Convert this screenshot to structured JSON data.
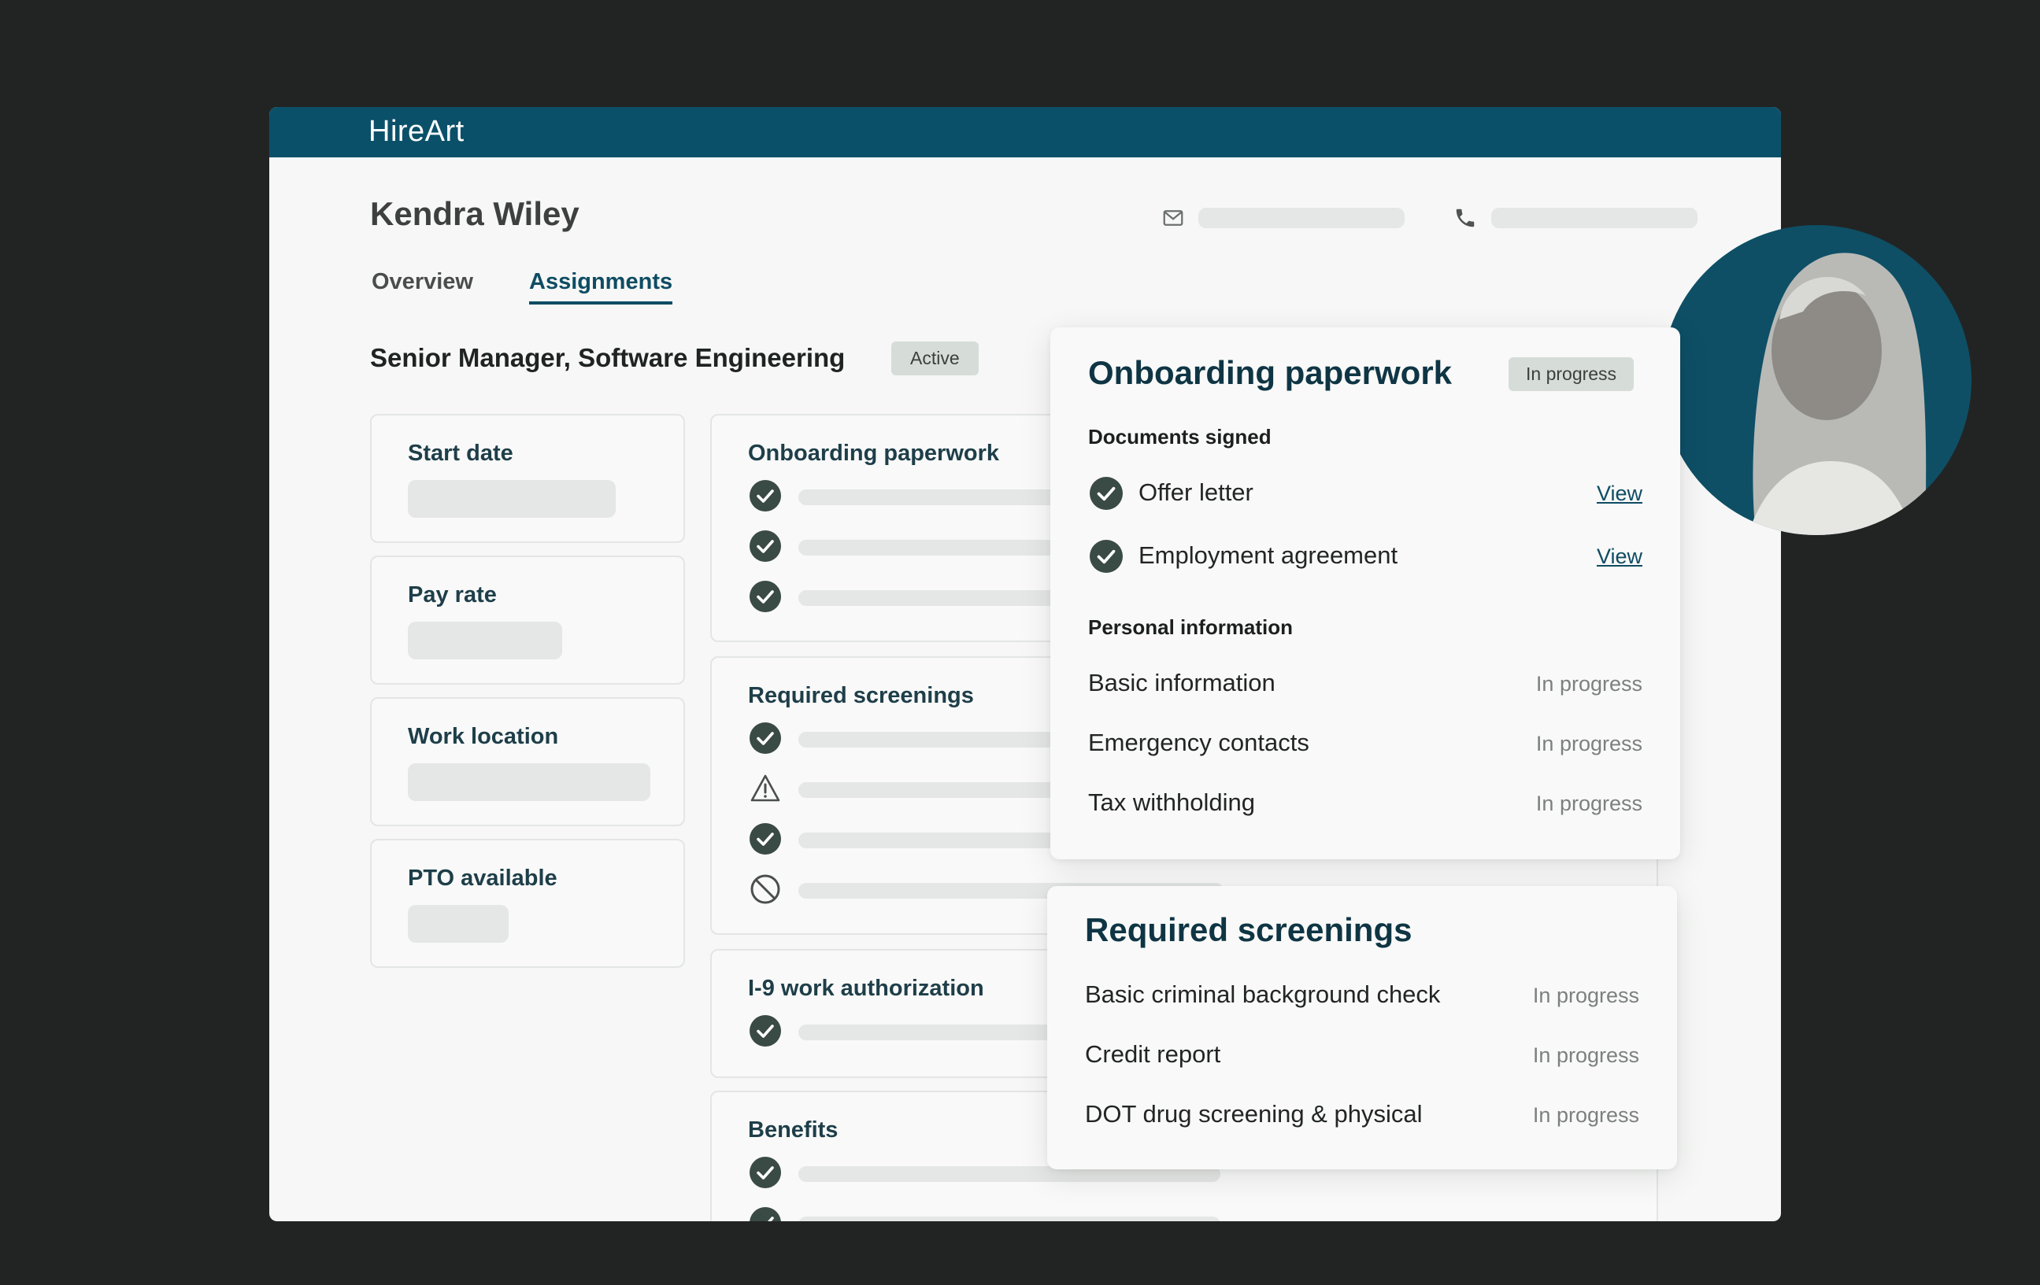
{
  "app": {
    "logo": "HireArt"
  },
  "profile": {
    "name": "Kendra Wiley"
  },
  "contact": {
    "email_icon": "mail-icon",
    "phone_icon": "phone-icon"
  },
  "tabs": [
    {
      "label": "Overview",
      "active": false
    },
    {
      "label": "Assignments",
      "active": true
    }
  ],
  "assignment": {
    "title": "Senior Manager, Software Engineering",
    "status": "Active"
  },
  "info_cards": [
    {
      "label": "Start date"
    },
    {
      "label": "Pay rate"
    },
    {
      "label": "Work location"
    },
    {
      "label": "PTO available"
    }
  ],
  "task_cards": [
    {
      "label": "Onboarding paperwork",
      "items": [
        "check",
        "check",
        "check"
      ]
    },
    {
      "label": "Required screenings",
      "items": [
        "check",
        "warning",
        "check",
        "blocked"
      ]
    },
    {
      "label": "I-9 work authorization",
      "items": [
        "check"
      ]
    },
    {
      "label": "Benefits",
      "items": [
        "check",
        "check"
      ]
    }
  ],
  "onboarding_panel": {
    "title": "Onboarding paperwork",
    "status": "In progress",
    "documents_heading": "Documents signed",
    "documents": [
      {
        "label": "Offer letter",
        "action": "View"
      },
      {
        "label": "Employment agreement",
        "action": "View"
      }
    ],
    "personal_heading": "Personal information",
    "personal": [
      {
        "label": "Basic information",
        "status": "In progress"
      },
      {
        "label": "Emergency contacts",
        "status": "In progress"
      },
      {
        "label": "Tax withholding",
        "status": "In progress"
      }
    ]
  },
  "screenings_panel": {
    "title": "Required screenings",
    "items": [
      {
        "label": "Basic criminal background check",
        "status": "In progress"
      },
      {
        "label": "Credit report",
        "status": "In progress"
      },
      {
        "label": "DOT drug screening & physical",
        "status": "In progress"
      }
    ]
  },
  "colors": {
    "header": "#0b5069",
    "accent": "#0f4c63",
    "check": "#3a4a44",
    "background": "#222423"
  }
}
